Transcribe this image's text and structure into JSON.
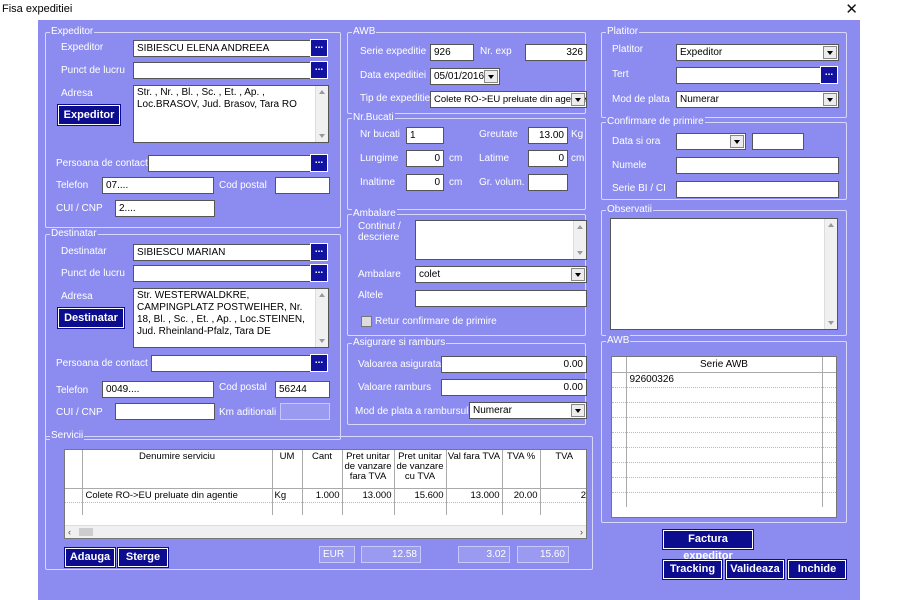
{
  "window": {
    "title": "Fisa expeditiei",
    "close": "✕"
  },
  "expeditor": {
    "legend": "Expeditor",
    "expeditor_label": "Expeditor",
    "expeditor_value": "SIBIESCU ELENA ANDREEA",
    "punct_label": "Punct de lucru",
    "punct_value": "",
    "adresa_label": "Adresa",
    "adresa_value": "Str. , Nr. , Bl. , Sc. , Et. , Ap. , Loc.BRASOV, Jud. Brasov, Tara RO",
    "button": "Expeditor",
    "contact_label": "Persoana de contact",
    "contact_value": "",
    "telefon_label": "Telefon",
    "telefon_value": "07....",
    "cod_postal_label": "Cod postal",
    "cod_postal_value": "",
    "cui_label": "CUI / CNP",
    "cui_value": "2...."
  },
  "destinatar": {
    "legend": "Destinatar",
    "destinatar_label": "Destinatar",
    "destinatar_value": "SIBIESCU MARIAN",
    "punct_label": "Punct de lucru",
    "punct_value": "",
    "adresa_label": "Adresa",
    "adresa_value": "Str. WESTERWALDKRE, CAMPINGPLATZ POSTWEIHER, Nr. 18, Bl. , Sc. , Et. , Ap. , Loc.STEINEN, Jud. Rheinland-Pfalz, Tara DE",
    "button": "Destinatar",
    "contact_label": "Persoana de contact",
    "contact_value": "",
    "telefon_label": "Telefon",
    "telefon_value": "0049....",
    "cod_postal_label": "Cod postal",
    "cod_postal_value": "56244",
    "cui_label": "CUI / CNP",
    "cui_value": "",
    "km_label": "Km aditionali",
    "km_value": ""
  },
  "awb": {
    "legend": "AWB",
    "serie_label": "Serie expeditie",
    "serie_value": "926",
    "nr_label": "Nr. exp",
    "nr_value": "326",
    "data_label": "Data expeditiei",
    "data_value": "05/01/2016",
    "tip_label": "Tip de expeditie",
    "tip_value": "Colete RO->EU preluate din agentie"
  },
  "bucati": {
    "legend": "Nr.Bucati",
    "nr_label": "Nr bucati",
    "nr_value": "1",
    "greutate_label": "Greutate",
    "greutate_value": "13.00",
    "greutate_unit": "Kg",
    "lungime_label": "Lungime",
    "lungime_value": "0",
    "lungime_unit": "cm",
    "latime_label": "Latime",
    "latime_value": "0",
    "latime_unit": "cm",
    "inaltime_label": "Inaltime",
    "inaltime_value": "0",
    "inaltime_unit": "cm",
    "volum_label": "Gr. volum.",
    "volum_value": ""
  },
  "ambalare": {
    "legend": "Ambalare",
    "continut_label": "Continut / descriere",
    "continut_value": "",
    "ambalare_label": "Ambalare",
    "ambalare_value": "colet",
    "altele_label": "Altele",
    "altele_value": "",
    "retur_label": "Retur confirmare de primire"
  },
  "asigurare": {
    "legend": "Asigurare si ramburs",
    "valoare_asig_label": "Valoarea asigurata",
    "valoare_asig_value": "0.00",
    "ramburs_label": "Valoare ramburs",
    "ramburs_value": "0.00",
    "mod_label": "Mod de plata a rambursului",
    "mod_value": "Numerar"
  },
  "platitor": {
    "legend": "Platitor",
    "platitor_label": "Platitor",
    "platitor_value": "Expeditor",
    "tert_label": "Tert",
    "tert_value": "",
    "mod_label": "Mod de plata",
    "mod_value": "Numerar"
  },
  "confirmare": {
    "legend": "Confirmare de primire",
    "data_label": "Data si ora",
    "data_value": "",
    "ora_value": "",
    "numele_label": "Numele",
    "numele_value": "",
    "serie_label": "Serie BI / CI",
    "serie_value": ""
  },
  "observatii": {
    "legend": "Observatii",
    "value": ""
  },
  "awb_list": {
    "legend": "AWB",
    "header": "Serie AWB",
    "rows": [
      "92600326"
    ]
  },
  "servicii": {
    "legend": "Servicii",
    "columns": [
      "Denumire serviciu",
      "UM",
      "Cant",
      "Pret unitar de vanzare fara TVA",
      "Pret unitar de vanzare cu TVA",
      "Val fara TVA",
      "TVA %",
      "TVA"
    ],
    "rows": [
      {
        "denumire": "Colete RO->EU preluate din agentie",
        "um": "Kg",
        "cant": "1.000",
        "pret_fara": "13.000",
        "pret_cu": "15.600",
        "val": "13.000",
        "tva_pct": "20.00",
        "tva": "2"
      }
    ],
    "add_button": "Adauga",
    "delete_button": "Sterge",
    "currency": "EUR",
    "total_fara": "12.58",
    "total_tva": "3.02",
    "total": "15.60"
  },
  "actions": {
    "factura": "Factura expeditor",
    "tracking": "Tracking",
    "valideaza": "Valideaza",
    "inchide": "Inchide"
  }
}
